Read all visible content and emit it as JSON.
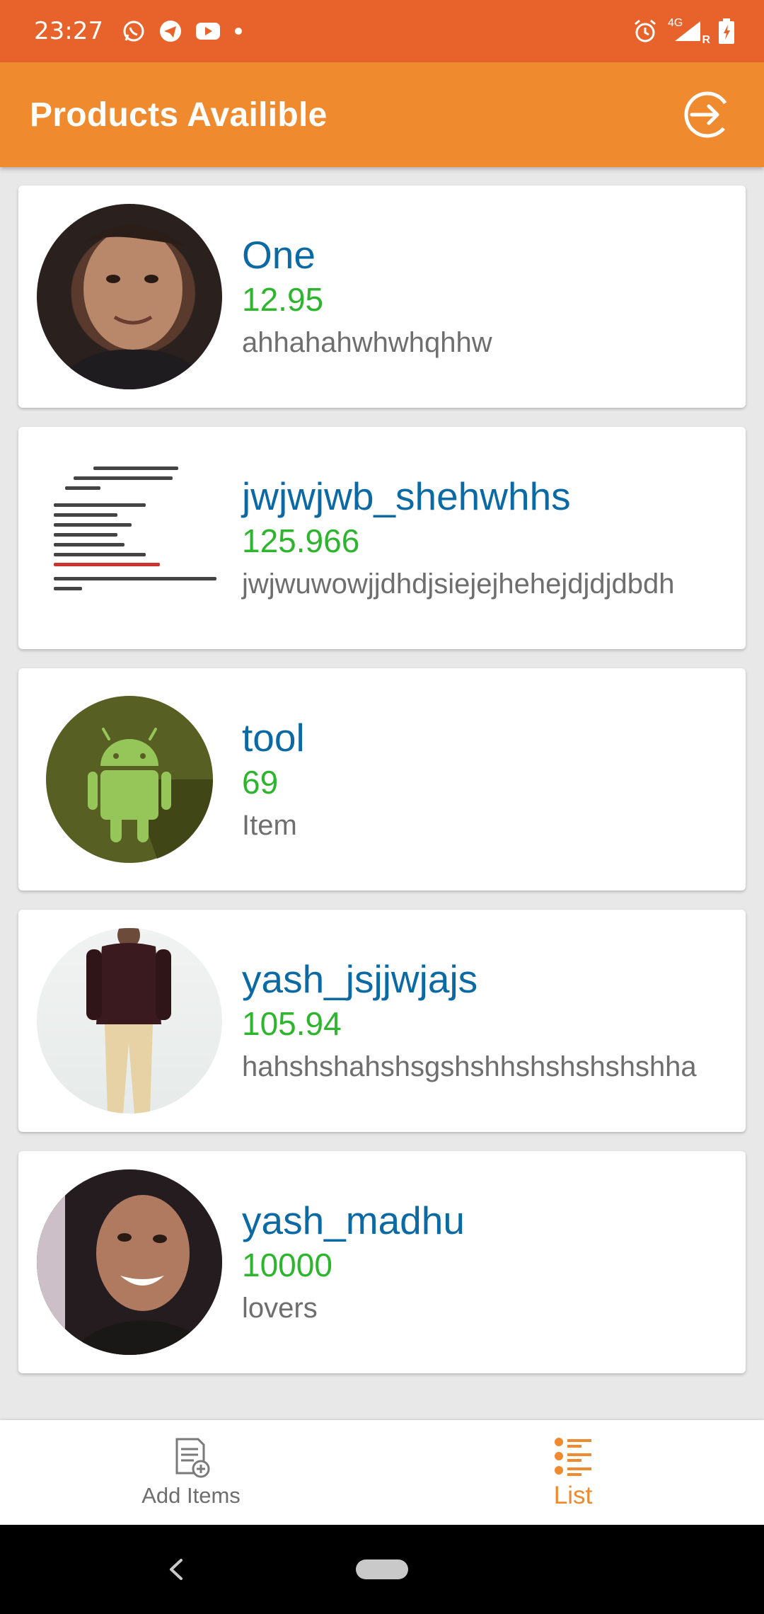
{
  "status_bar": {
    "time": "23:27",
    "left_icons": [
      "whatsapp-icon",
      "telegram-icon",
      "youtube-icon",
      "dot-icon"
    ],
    "right_icons": [
      "alarm-icon",
      "signal-4g-icon",
      "battery-icon"
    ],
    "network": "4G",
    "roaming": "R"
  },
  "app_bar": {
    "title": "Products Availible",
    "action_icon": "logout-icon"
  },
  "products": [
    {
      "name": "One",
      "price": "12.95",
      "description": "ahhahahwhwhqhhw",
      "thumb": "photo"
    },
    {
      "name": "jwjwjwb_shehwhhs",
      "price": "125.966",
      "description": "jwjwuwowjjdhdjsiejejhehejdjdjdbdh",
      "thumb": "document"
    },
    {
      "name": "tool",
      "price": "69",
      "description": "Item",
      "thumb": "android"
    },
    {
      "name": "yash_jsjjwjajs",
      "price": "105.94",
      "description": "hahshshahshsgshshhshshshshshha",
      "thumb": "photo"
    },
    {
      "name": "yash_madhu",
      "price": "10000",
      "description": "lovers",
      "thumb": "photo"
    }
  ],
  "bottom_nav": {
    "items": [
      {
        "label": "Add Items",
        "icon": "add-document-icon",
        "active": false
      },
      {
        "label": "List",
        "icon": "list-icon",
        "active": true
      }
    ]
  },
  "colors": {
    "status_bar": "#e8632b",
    "app_bar": "#ef8a2f",
    "name": "#0b69a3",
    "price": "#2db62d",
    "description": "#6e6e6e",
    "nav_active": "#ef8a2f"
  }
}
